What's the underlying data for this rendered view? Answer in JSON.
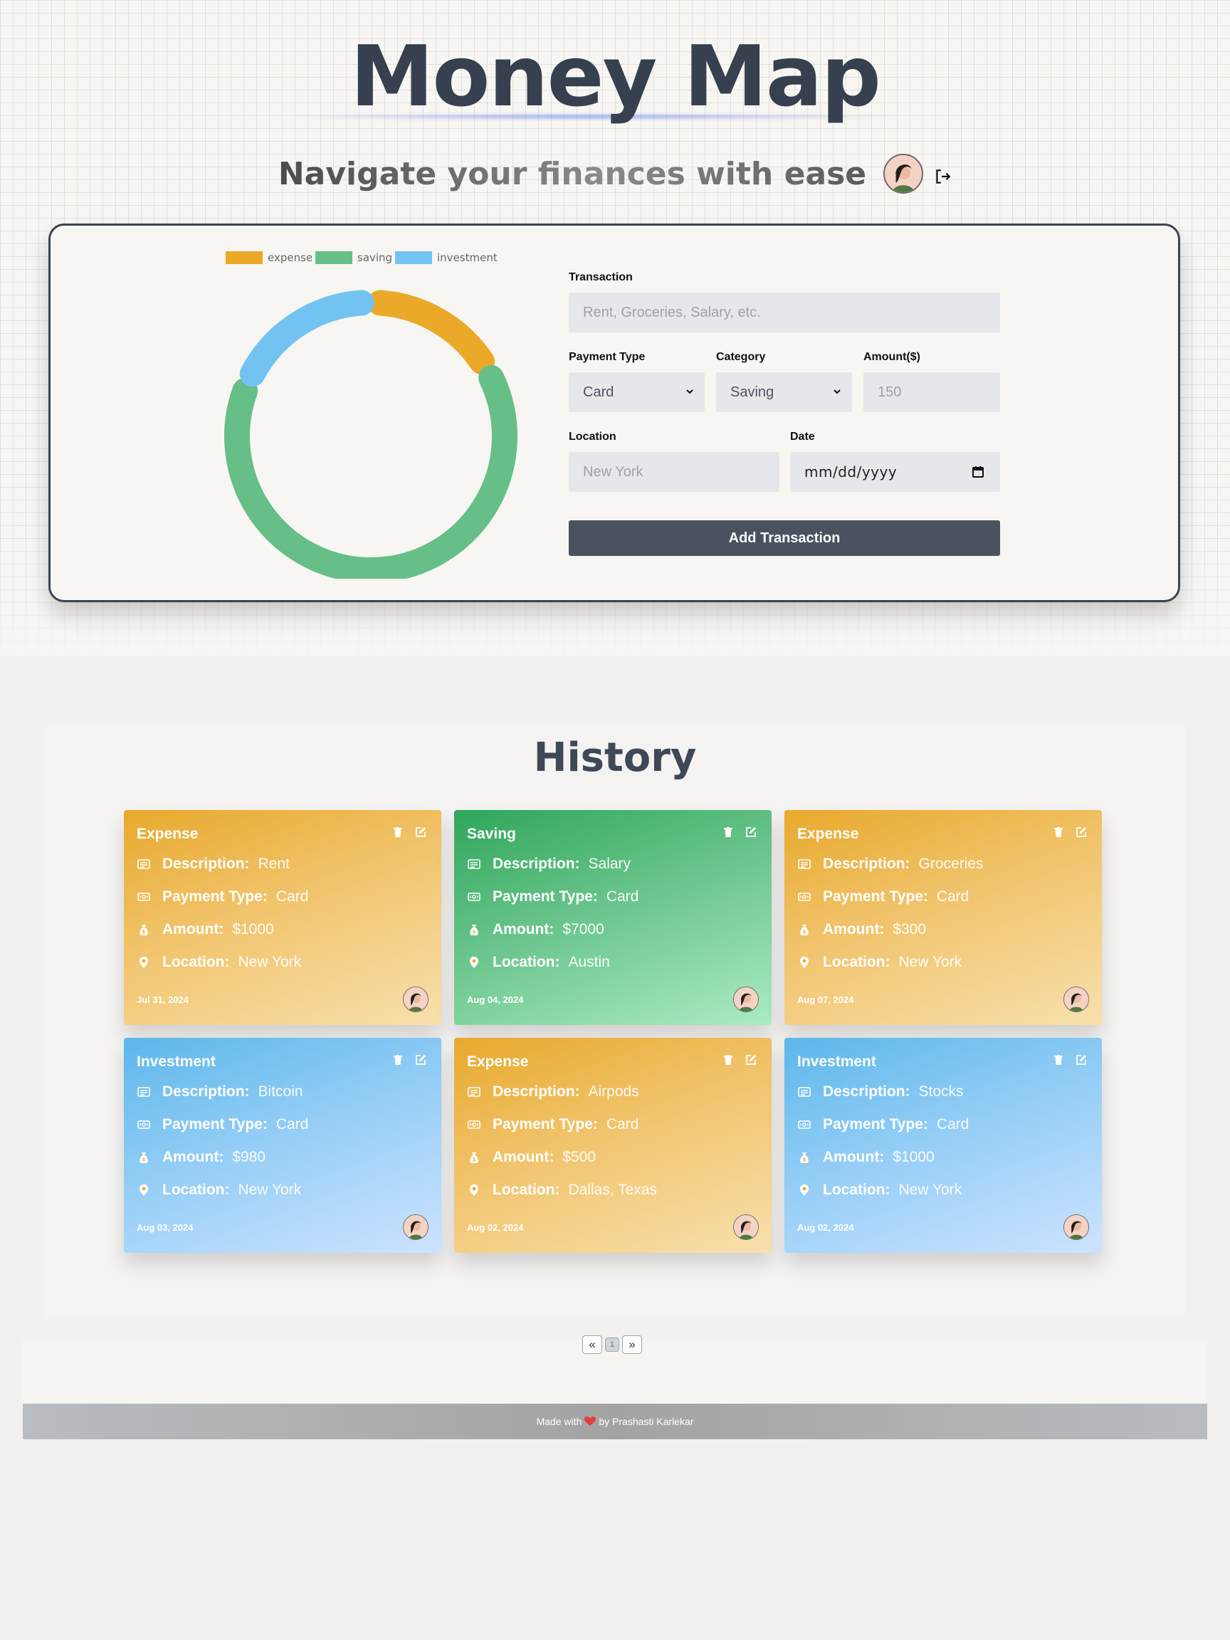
{
  "app": {
    "title": "Money Map",
    "subtitle": "Navigate your finances with ease"
  },
  "chart": {
    "legend": [
      {
        "label": "expense",
        "color": "#eaa928"
      },
      {
        "label": "saving",
        "color": "#66bf87"
      },
      {
        "label": "investment",
        "color": "#72c3f2"
      }
    ]
  },
  "chart_data": {
    "type": "pie",
    "categories": [
      "expense",
      "saving",
      "investment"
    ],
    "values": [
      1800,
      7000,
      1980
    ],
    "colors": [
      "#eaa928",
      "#66bf87",
      "#72c3f2"
    ],
    "legend_position": "top"
  },
  "form": {
    "transaction_label": "Transaction",
    "transaction_placeholder": "Rent, Groceries, Salary, etc.",
    "payment_type_label": "Payment Type",
    "payment_type_value": "Card",
    "category_label": "Category",
    "category_value": "Saving",
    "amount_label": "Amount($)",
    "amount_placeholder": "150",
    "location_label": "Location",
    "location_placeholder": "New York",
    "date_label": "Date",
    "date_placeholder": "mm/dd/yyyy",
    "submit_label": "Add Transaction"
  },
  "history": {
    "title": "History",
    "labels": {
      "description": "Description:",
      "payment_type": "Payment Type:",
      "amount": "Amount:",
      "location": "Location:"
    },
    "cards": [
      {
        "category": "Expense",
        "type": "expense",
        "description": "Rent",
        "payment_type": "Card",
        "amount": "$1000",
        "location": "New York",
        "date": "Jul 31, 2024"
      },
      {
        "category": "Saving",
        "type": "saving",
        "description": "Salary",
        "payment_type": "Card",
        "amount": "$7000",
        "location": "Austin",
        "date": "Aug 04, 2024"
      },
      {
        "category": "Expense",
        "type": "expense",
        "description": "Groceries",
        "payment_type": "Card",
        "amount": "$300",
        "location": "New York",
        "date": "Aug 07, 2024"
      },
      {
        "category": "Investment",
        "type": "investment",
        "description": "Bitcoin",
        "payment_type": "Card",
        "amount": "$980",
        "location": "New York",
        "date": "Aug 03, 2024"
      },
      {
        "category": "Expense",
        "type": "expense",
        "description": "Airpods",
        "payment_type": "Card",
        "amount": "$500",
        "location": "Dallas, Texas",
        "date": "Aug 02, 2024"
      },
      {
        "category": "Investment",
        "type": "investment",
        "description": "Stocks",
        "payment_type": "Card",
        "amount": "$1000",
        "location": "New York",
        "date": "Aug 02, 2024"
      }
    ]
  },
  "pagination": {
    "prev": "«",
    "page": "1",
    "next": "»"
  },
  "footer": {
    "made_with": "Made with",
    "by": "by Prashasti Karlekar"
  }
}
